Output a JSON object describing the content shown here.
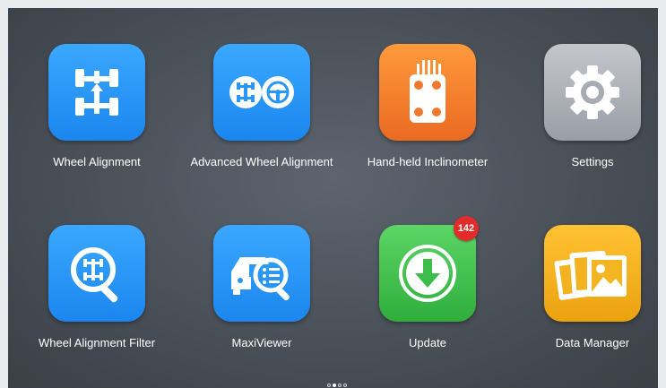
{
  "apps": [
    {
      "label": "Wheel Alignment",
      "icon": "wheel-alignment-icon"
    },
    {
      "label": "Advanced Wheel Alignment",
      "icon": "advanced-wheel-alignment-icon"
    },
    {
      "label": "Hand-held Inclinometer",
      "icon": "inclinometer-icon"
    },
    {
      "label": "Settings",
      "icon": "gear-icon"
    },
    {
      "label": "Wheel Alignment Filter",
      "icon": "alignment-filter-icon"
    },
    {
      "label": "MaxiViewer",
      "icon": "maxiviewer-icon"
    },
    {
      "label": "Update",
      "icon": "download-arrow-icon",
      "badge": "142"
    },
    {
      "label": "Data Manager",
      "icon": "photo-gallery-icon"
    }
  ],
  "pager": {
    "pages": 4,
    "current": 2
  },
  "colors": {
    "blue": "#1f8ff0",
    "orange": "#f07a2c",
    "gray": "#a9adb4",
    "green": "#3dbd4a",
    "yellow": "#f3b21f",
    "badge": "#e22b2b"
  }
}
